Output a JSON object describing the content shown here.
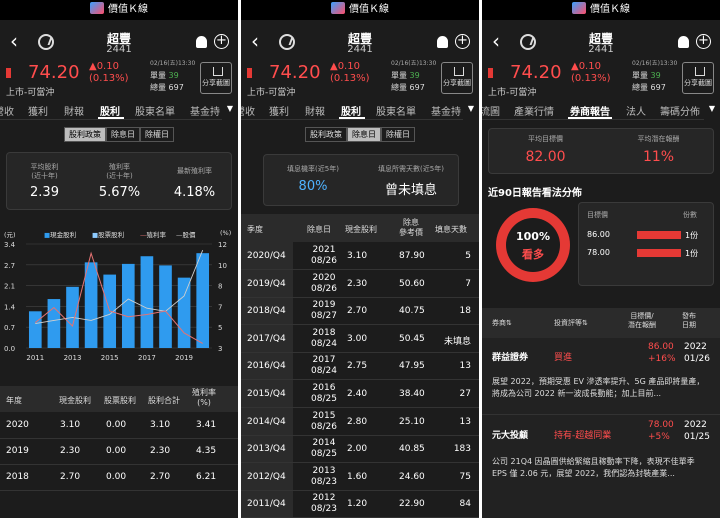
{
  "app": {
    "title": "價值Ｋ線"
  },
  "stock": {
    "name": "超豐",
    "code": "2441",
    "price": "74.20",
    "change": "▲0.10",
    "change_pct": "(0.13%)",
    "market": "上市-可當沖",
    "timestamp": "02/16(五)13:30",
    "vol_label": "單量",
    "vol_value": "39",
    "total_label": "總量",
    "total_value": "697",
    "share_label": "分享截圖"
  },
  "colors": {
    "up": "#ff4d4d",
    "bar": "#2f9bef",
    "payout": "#e57373",
    "price_line": "#cfcfcf"
  },
  "p1": {
    "tabs": [
      "營收",
      "獲利",
      "財報",
      "股利",
      "股東名單",
      "基金持"
    ],
    "segments": [
      "股利政策",
      "除息日",
      "除權日"
    ],
    "summary": [
      {
        "label": "平均股利\n(近十年)",
        "value": "2.39"
      },
      {
        "label": "殖利率\n(近十年)",
        "value": "5.67%"
      },
      {
        "label": "最新殖利率",
        "value": "4.18%"
      }
    ],
    "legend": [
      "(元)",
      "■現金股利",
      "■股票股利",
      "—殖利率",
      "—股價",
      "(%)"
    ],
    "table_headers": [
      "年度",
      "現金股利",
      "股票股利",
      "股利合計",
      "殖利率\n(%)"
    ],
    "rows": [
      [
        "2020",
        "3.10",
        "0.00",
        "3.10",
        "3.41"
      ],
      [
        "2019",
        "2.30",
        "0.00",
        "2.30",
        "4.35"
      ],
      [
        "2018",
        "2.70",
        "0.00",
        "2.70",
        "6.21"
      ]
    ]
  },
  "p2": {
    "tabs": [
      "營收",
      "獲利",
      "財報",
      "股利",
      "股東名單",
      "基金持"
    ],
    "segments": [
      "股利政策",
      "除息日",
      "除權日"
    ],
    "summary": [
      {
        "label": "填息機率(近5年)",
        "value": "80%"
      },
      {
        "label": "填息所需天數(近5年)",
        "value": "曾未填息"
      }
    ],
    "table_headers": [
      "季度",
      "除息日",
      "現金股利",
      "除息\n參考價",
      "填息天數"
    ],
    "rows": [
      [
        "2020/Q4",
        "2021\n08/26",
        "3.10",
        "87.90",
        "5"
      ],
      [
        "2019/Q4",
        "2020\n08/26",
        "2.30",
        "50.60",
        "7"
      ],
      [
        "2018/Q4",
        "2019\n08/27",
        "2.70",
        "40.75",
        "18"
      ],
      [
        "2017/Q4",
        "2018\n08/24",
        "3.00",
        "50.45",
        "未填息"
      ],
      [
        "2016/Q4",
        "2017\n08/24",
        "2.75",
        "47.95",
        "13"
      ],
      [
        "2015/Q4",
        "2016\n08/25",
        "2.40",
        "38.40",
        "27"
      ],
      [
        "2014/Q4",
        "2015\n08/26",
        "2.80",
        "25.10",
        "13"
      ],
      [
        "2013/Q4",
        "2014\n08/25",
        "2.00",
        "40.85",
        "183"
      ],
      [
        "2012/Q4",
        "2013\n08/23",
        "1.60",
        "24.60",
        "75"
      ],
      [
        "2011/Q4",
        "2012\n08/23",
        "1.20",
        "22.90",
        "84"
      ]
    ]
  },
  "p3": {
    "tabs": [
      "流圖",
      "產業行情",
      "券商報告",
      "法人",
      "籌碼分佈"
    ],
    "summary": [
      {
        "label": "平均目標價",
        "value": "82.00"
      },
      {
        "label": "平均潛在報酬",
        "value": "11%"
      }
    ],
    "dist_title": "近90日報告看法分佈",
    "donut_pct": "100%",
    "donut_label": "看多",
    "dist_headers": [
      "目標價",
      "份數"
    ],
    "dist_rows": [
      [
        "86.00",
        "1份"
      ],
      [
        "78.00",
        "1份"
      ]
    ],
    "table_headers": [
      "券商",
      "投資評等",
      "目標價/\n潛在報酬",
      "發布\n日期"
    ],
    "reports": [
      {
        "broker": "群益證券",
        "rating": "買進",
        "target": "86.00",
        "upside": "+16%",
        "year": "2022",
        "date": "01/26",
        "summary": "展望 2022，預期受惠 EV 滲透率提升、5G 產品即將量產，將成為公司 2022 新一波成長動能；加上目前..."
      },
      {
        "broker": "元大投顧",
        "rating": "持有-超越同業",
        "target": "78.00",
        "upside": "+5%",
        "year": "2022",
        "date": "01/25",
        "summary": "公司 21Q4 因晶圓供給緊縮且稼動率下降，表現不佳單季 EPS 僅 2.06 元，展望 2022，我們認為封裝產業..."
      }
    ]
  },
  "chart_data": {
    "type": "bar",
    "categories": [
      "2011",
      "2012",
      "2013",
      "2014",
      "2015",
      "2016",
      "2017",
      "2018",
      "2019",
      "2020"
    ],
    "series": [
      {
        "name": "現金股利",
        "values": [
          1.2,
          1.6,
          2.0,
          2.8,
          2.4,
          2.75,
          3.0,
          2.7,
          2.3,
          3.1
        ]
      },
      {
        "name": "股票股利",
        "values": [
          0,
          0,
          0,
          0,
          0,
          0,
          0,
          0,
          0,
          0
        ]
      },
      {
        "name": "殖利率",
        "values": [
          5.2,
          6.5,
          4.9,
          11.2,
          6.2,
          5.7,
          5.9,
          6.2,
          4.3,
          3.4
        ]
      },
      {
        "name": "股價",
        "values": [
          0.8,
          0.9,
          1.0,
          0.9,
          1.1,
          1.6,
          1.3,
          1.2,
          1.7,
          3.2
        ]
      }
    ],
    "yticks_left": [
      "3.4",
      "2.7",
      "2.1",
      "1.4",
      "0.7",
      "0.0"
    ],
    "yticks_right": [
      "12",
      "10",
      "8",
      "7",
      "5",
      "3"
    ],
    "xticks": [
      "2011",
      "2013",
      "2015",
      "2017",
      "2019"
    ],
    "ylim": [
      0,
      3.4
    ],
    "ylim_right": [
      3,
      12
    ]
  }
}
